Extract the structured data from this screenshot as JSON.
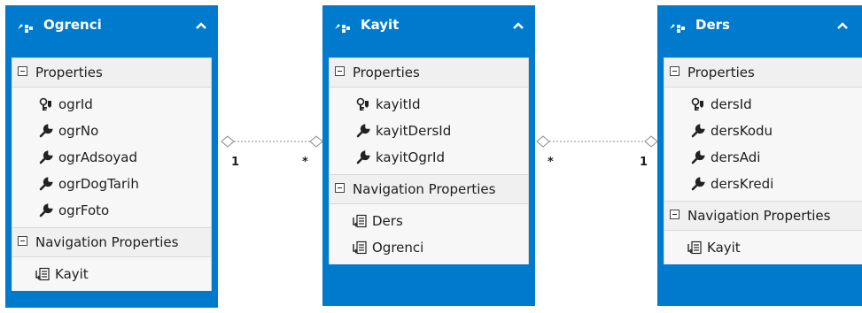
{
  "entities": {
    "ogrenci": {
      "name": "Ogrenci",
      "properties_label": "Properties",
      "properties": [
        "ogrId",
        "ogrNo",
        "ogrAdsoyad",
        "ogrDogTarih",
        "ogrFoto"
      ],
      "navigation_label": "Navigation Properties",
      "navigation": [
        "Kayit"
      ]
    },
    "kayit": {
      "name": "Kayit",
      "properties_label": "Properties",
      "properties": [
        "kayitId",
        "kayitDersId",
        "kayitOgrId"
      ],
      "navigation_label": "Navigation Properties",
      "navigation": [
        "Ders",
        "Ogrenci"
      ]
    },
    "ders": {
      "name": "Ders",
      "properties_label": "Properties",
      "properties": [
        "dersId",
        "dersKodu",
        "dersAdi",
        "dersKredi"
      ],
      "navigation_label": "Navigation Properties",
      "navigation": [
        "Kayit"
      ]
    }
  },
  "associations": [
    {
      "from": "Ogrenci",
      "to": "Kayit",
      "from_mult": "1",
      "to_mult": "*"
    },
    {
      "from": "Kayit",
      "to": "Ders",
      "from_mult": "*",
      "to_mult": "1"
    }
  ],
  "colors": {
    "header": "#007acc",
    "section_bg": "#f7f7f7",
    "connector": "#8a8a8a"
  }
}
